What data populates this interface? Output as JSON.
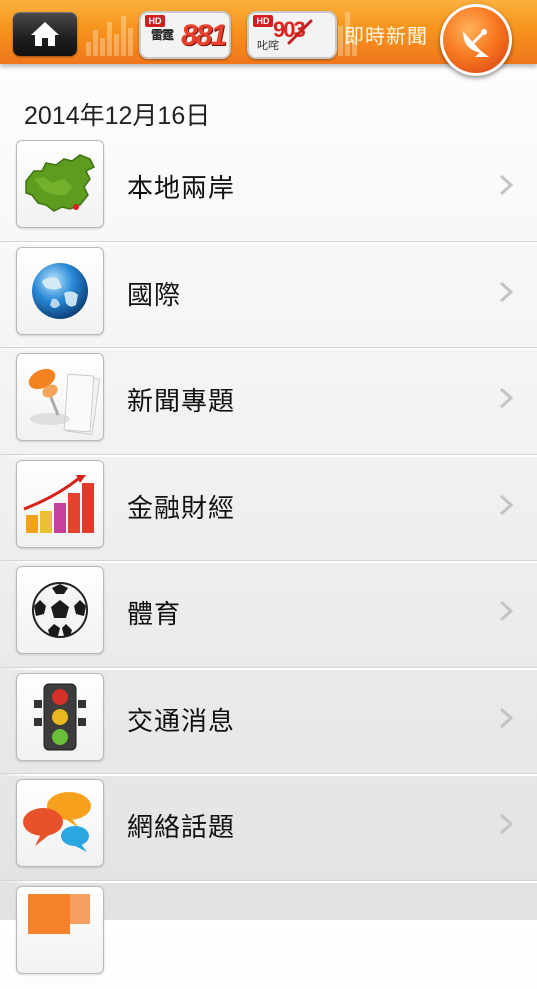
{
  "header": {
    "home_label": "home",
    "station_881": {
      "hd": "HD",
      "name_cn": "雷霆",
      "number": "881"
    },
    "station_903": {
      "hd": "HD",
      "name_cn": "叱咤",
      "number": "903"
    },
    "realtime_news": "即時新聞"
  },
  "date": "2014年12月16日",
  "categories": [
    {
      "label": "本地兩岸",
      "icon": "china-map-icon"
    },
    {
      "label": "國際",
      "icon": "globe-icon"
    },
    {
      "label": "新聞專題",
      "icon": "pushpin-icon"
    },
    {
      "label": "金融財經",
      "icon": "bar-chart-icon"
    },
    {
      "label": "體育",
      "icon": "soccer-ball-icon"
    },
    {
      "label": "交通消息",
      "icon": "traffic-light-icon"
    },
    {
      "label": "網絡話題",
      "icon": "speech-bubbles-icon"
    },
    {
      "label": "",
      "icon": "partial-orange-icon"
    }
  ]
}
